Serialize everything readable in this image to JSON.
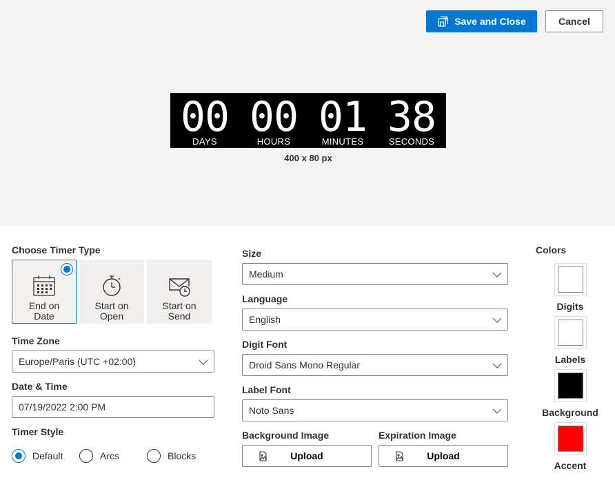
{
  "toolbar": {
    "save_label": "Save and Close",
    "cancel_label": "Cancel"
  },
  "preview": {
    "units": [
      {
        "value": "00",
        "label": "DAYS"
      },
      {
        "value": "00",
        "label": "HOURS"
      },
      {
        "value": "01",
        "label": "MINUTES"
      },
      {
        "value": "38",
        "label": "SECONDS"
      }
    ],
    "size_caption": "400 x 80 px"
  },
  "timer_type": {
    "heading": "Choose Timer Type",
    "options": [
      {
        "label": "End on Date",
        "icon": "calendar-icon",
        "selected": true
      },
      {
        "label": "Start on Open",
        "icon": "stopwatch-icon",
        "selected": false
      },
      {
        "label": "Start on Send",
        "icon": "mail-clock-icon",
        "selected": false
      }
    ]
  },
  "time_zone": {
    "label": "Time Zone",
    "value": "Europe/Paris (UTC +02:00)"
  },
  "date_time": {
    "label": "Date & Time",
    "value": "07/19/2022 2:00 PM"
  },
  "timer_style": {
    "label": "Timer Style",
    "options": [
      {
        "label": "Default",
        "selected": true
      },
      {
        "label": "Arcs",
        "selected": false
      },
      {
        "label": "Blocks",
        "selected": false
      }
    ]
  },
  "size": {
    "label": "Size",
    "value": "Medium"
  },
  "language": {
    "label": "Language",
    "value": "English"
  },
  "digit_font": {
    "label": "Digit Font",
    "value": "Droid Sans Mono Regular"
  },
  "label_font": {
    "label": "Label Font",
    "value": "Noto Sans"
  },
  "background_image": {
    "label": "Background Image",
    "button": "Upload"
  },
  "expiration_image": {
    "label": "Expiration Image",
    "button": "Upload"
  },
  "colors": {
    "heading": "Colors",
    "items": [
      {
        "label": "Digits",
        "color": "#ffffff"
      },
      {
        "label": "Labels",
        "color": "#ffffff"
      },
      {
        "label": "Background",
        "color": "#000000"
      },
      {
        "label": "Accent",
        "color": "#ff0000"
      }
    ]
  }
}
